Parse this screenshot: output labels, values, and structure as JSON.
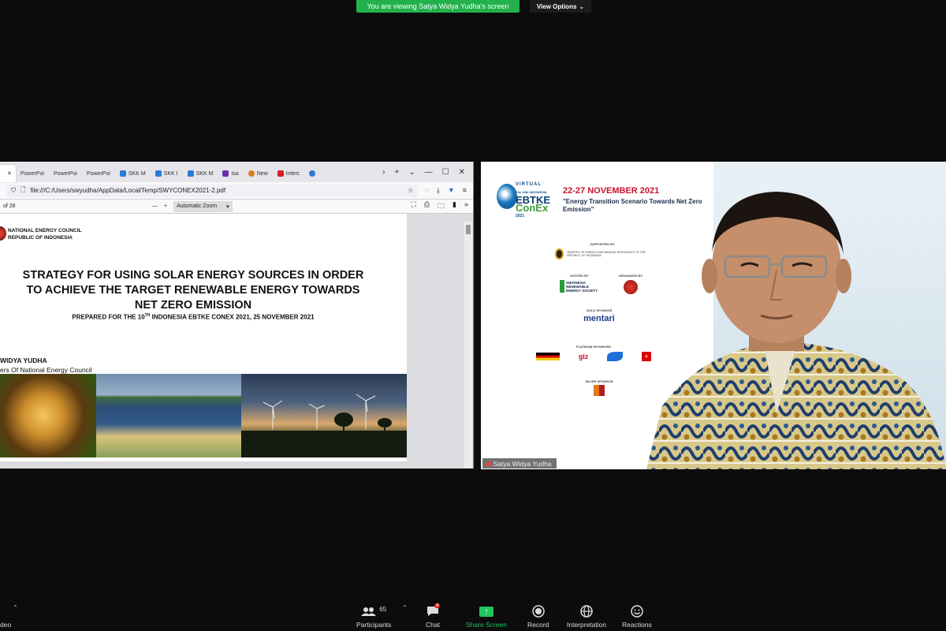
{
  "banner": {
    "text": "You are viewing Satya Widya Yudha's screen",
    "view_options": "View Options"
  },
  "browser": {
    "tabs": [
      {
        "label": "",
        "color": "#e04a3a",
        "active": true
      },
      {
        "label": "PowerPoi",
        "color": "#c8471f"
      },
      {
        "label": "PowerPoi",
        "color": "#c8471f"
      },
      {
        "label": "PowerPoi",
        "color": "#c8471f"
      },
      {
        "label": "SKK M",
        "color": "#2a7bd4"
      },
      {
        "label": "SKK I",
        "color": "#2a7bd4"
      },
      {
        "label": "SKK M",
        "color": "#2a7bd4"
      },
      {
        "label": "Isa",
        "color": "#6a2fb0"
      },
      {
        "label": "New",
        "color": "#e07a1e"
      },
      {
        "label": "Interc",
        "color": "#d42020"
      },
      {
        "label": "",
        "color": "#2a7bd4"
      }
    ],
    "url": "file:///C:/Users/swyudha/AppData/Local/Temp/SWYCONEX2021-2.pdf",
    "page_count": "of 28",
    "zoom": "Automatic Zoom"
  },
  "pdf": {
    "council_line1": "NATIONAL ENERGY COUNCIL",
    "council_line2": "REPUBLIC OF INDONESIA",
    "title": "STRATEGY FOR USING SOLAR ENERGY SOURCES IN ORDER TO ACHIEVE THE TARGET RENEWABLE ENERGY TOWARDS NET ZERO EMISSION",
    "subtitle_pre": "PREPARED FOR THE 10",
    "subtitle_sup": "TH",
    "subtitle_post": " INDONESIA EBTKE CONEX 2021, 25 NOVEMBER 2021",
    "author": "WIDYA YUDHA",
    "author_role": "ers Of National Energy Council"
  },
  "video": {
    "logo_top": "VIRTUAL",
    "logo_small": "The 10th INDONESIA",
    "logo_main": "EBTKE",
    "logo_conex": "ConEx",
    "logo_year": "2021",
    "dates": "22-27 NOVEMBER 2021",
    "theme": "\"Energy Transition Scenario Towards Net Zero Emission\"",
    "supported_by": "SUPPORTED BY",
    "ministry": "MINISTRY OF ENERGY AND MINERAL RESOURCES OF THE REPUBLIC OF INDONESIA",
    "hosted_by": "HOSTED BY",
    "organized_by": "ORGANIZED BY",
    "host_name": "INDONESIA RENEWABLE ENERGY SOCIETY",
    "host_abbr": "METI",
    "organizer_name": "",
    "gold_sponsor": "GOLD SPONSOR",
    "mentari": "mentari",
    "platinum": "PLATINUM SPONSORS",
    "giz": "giz",
    "silver": "SILVER SPONSOR",
    "participant_name": "Satya Widya Yudha"
  },
  "toolbar": {
    "video_label": "deo",
    "participants_label": "Participants",
    "participants_count": "65",
    "chat_label": "Chat",
    "chat_badge": "4",
    "share_label": "Share Screen",
    "record_label": "Record",
    "interpretation_label": "Interpretation",
    "reactions_label": "Reactions"
  }
}
